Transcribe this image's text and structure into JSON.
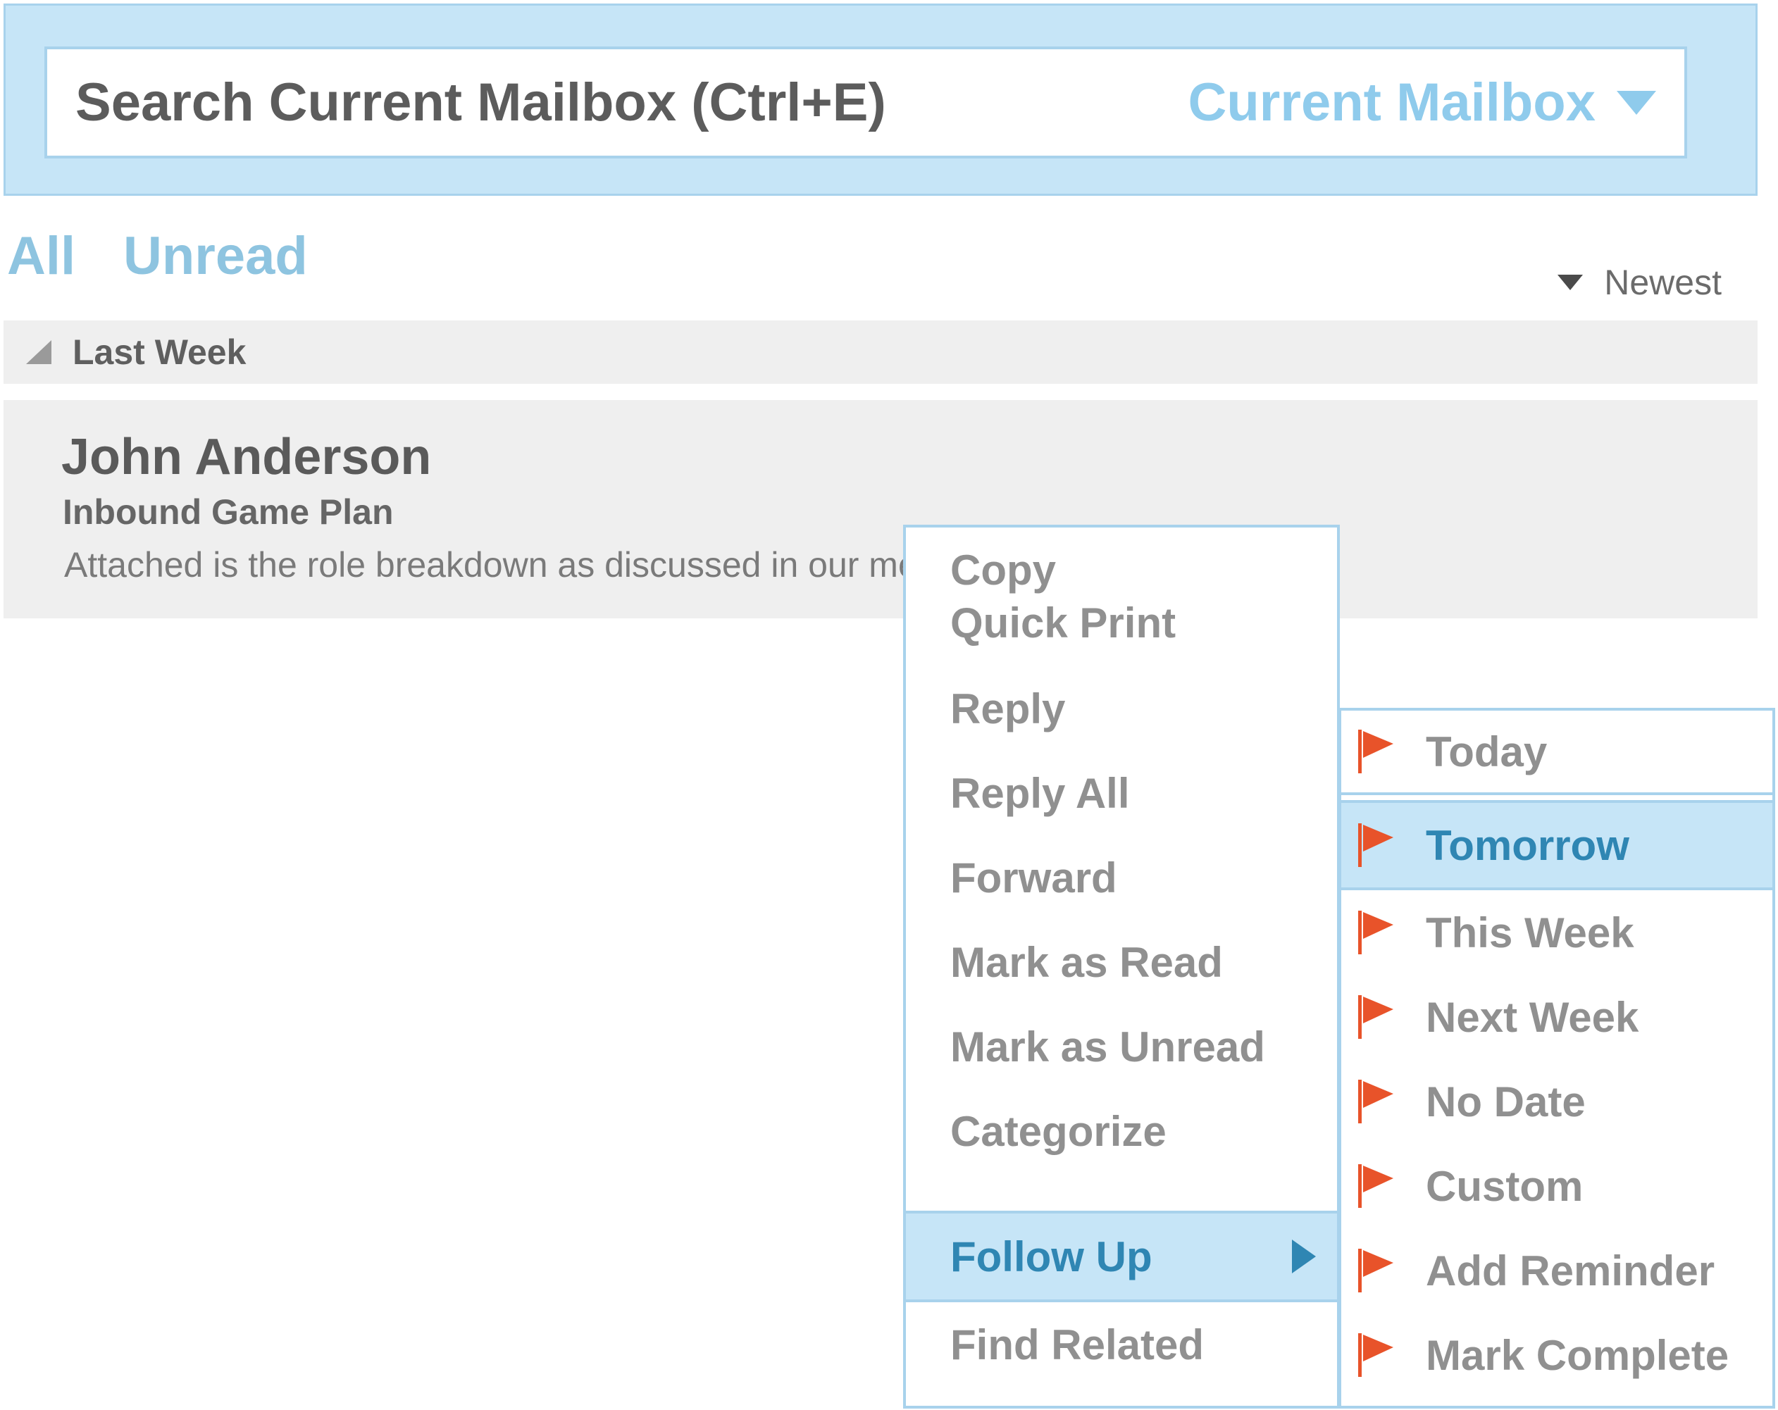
{
  "search": {
    "placeholder": "Search Current Mailbox (Ctrl+E)",
    "scope_label": "Current Mailbox"
  },
  "filters": {
    "all": "All",
    "unread": "Unread"
  },
  "sort": {
    "label": "Newest"
  },
  "group": {
    "label": "Last Week"
  },
  "message": {
    "sender": "John Anderson",
    "subject": "Inbound Game Plan",
    "preview": "Attached is the role breakdown as discussed in our meeting"
  },
  "context_menu": {
    "items": [
      {
        "label": "Copy"
      },
      {
        "label": "Quick Print"
      },
      {
        "label": "Reply"
      },
      {
        "label": "Reply All"
      },
      {
        "label": "Forward"
      },
      {
        "label": "Mark as Read"
      },
      {
        "label": "Mark as Unread"
      },
      {
        "label": "Categorize"
      },
      {
        "label": "Follow Up",
        "highlighted": true,
        "has_submenu": true
      },
      {
        "label": "Find Related"
      }
    ]
  },
  "follow_up_submenu": {
    "flag_icon": "flag-icon",
    "flag_color": "#e8532a",
    "items": [
      {
        "label": "Today"
      },
      {
        "label": "Tomorrow",
        "highlighted": true
      },
      {
        "label": "This Week"
      },
      {
        "label": "Next Week"
      },
      {
        "label": "No Date"
      },
      {
        "label": "Custom"
      },
      {
        "label": "Add Reminder"
      },
      {
        "label": "Mark Complete"
      }
    ]
  },
  "colors": {
    "accent_light": "#c6e5f7",
    "accent_border": "#a8d2ec",
    "accent_text": "#8fcbec",
    "highlight_text": "#2f86b3",
    "flag": "#e8532a"
  }
}
